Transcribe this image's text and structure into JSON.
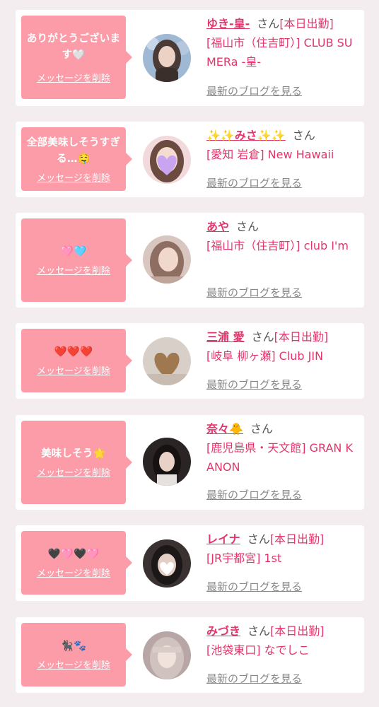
{
  "cards": [
    {
      "message": "ありがとうございます🤍",
      "delete_label": "メッセージを削除",
      "name": "ゆき-皇-",
      "honorific": "さん",
      "badge": "[本日出勤]",
      "shop": "[福山市（住吉町）] CLUB SUMERa -皇-",
      "blog_label": "最新のブログを見る",
      "avatar": "woman-portrait-blue-background"
    },
    {
      "message": "全部美味しそうすぎる…🤤",
      "delete_label": "メッセージを削除",
      "name": "✨✨みさ✨✨",
      "honorific": "さん",
      "badge": "",
      "shop": "[愛知 岩倉] New Hawaii",
      "blog_label": "最新のブログを見る",
      "avatar": "woman-portrait-heart-sticker"
    },
    {
      "message": "🩷🩵",
      "delete_label": "メッセージを削除",
      "name": "あや",
      "honorific": "さん",
      "badge": "",
      "shop": "[福山市（住吉町）] club I'm",
      "blog_label": "最新のブログを見る",
      "avatar": "woman-portrait"
    },
    {
      "message": "❤️❤️❤️",
      "delete_label": "メッセージを削除",
      "name": "三浦 愛",
      "honorific": "さん",
      "badge": "[本日出勤]",
      "shop": "[岐阜 柳ヶ瀬] Club JIN",
      "blog_label": "最新のブログを見る",
      "avatar": "heart-hand-photo"
    },
    {
      "message": "美味しそう🌟",
      "delete_label": "メッセージを削除",
      "name": "奈々🐥",
      "honorific": "さん",
      "badge": "",
      "shop": "[鹿児島県・天文館] GRAN KANON",
      "blog_label": "最新のブログを見る",
      "avatar": "woman-portrait-dark"
    },
    {
      "message": "🖤🩷🖤🩷",
      "delete_label": "メッセージを削除",
      "name": "レイナ",
      "honorific": "さん",
      "badge": "[本日出勤]",
      "shop": "[JR宇都宮] 1st",
      "blog_label": "最新のブログを見る",
      "avatar": "woman-portrait-heart-sticker-white"
    },
    {
      "message": "🐈‍⬛🐾",
      "delete_label": "メッセージを削除",
      "name": "みづき",
      "honorific": "さん",
      "badge": "[本日出勤]",
      "shop": "[池袋東口] なでしこ",
      "blog_label": "最新のブログを見る",
      "avatar": "woman-portrait-light"
    }
  ]
}
